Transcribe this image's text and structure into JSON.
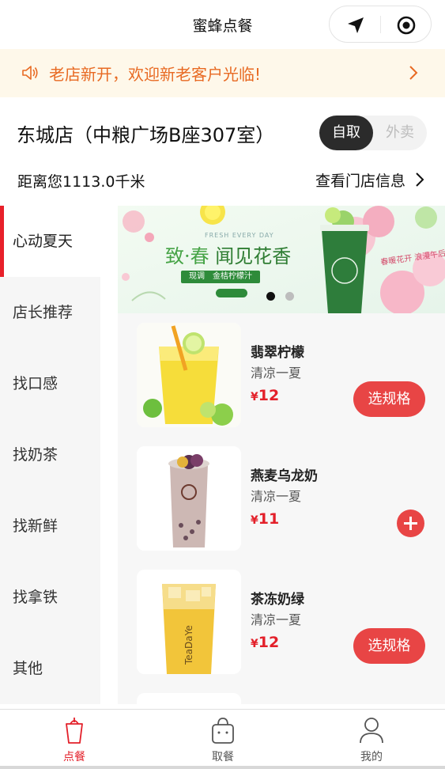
{
  "topbar": {
    "title": "蜜蜂点餐",
    "icons": [
      "location-arrow-icon",
      "target-icon"
    ]
  },
  "notice": {
    "text": "老店新开，欢迎新老客户光临!",
    "icon": "speaker-icon"
  },
  "store": {
    "name": "东城店（中粮广场B座307室）",
    "distance": "距离您1113.0千米",
    "info_link": "查看门店信息",
    "mode_selected": "自取",
    "mode_other": "外卖"
  },
  "categories": [
    {
      "label": "心动夏天",
      "active": true
    },
    {
      "label": "店长推荐",
      "active": false
    },
    {
      "label": "找口感",
      "active": false
    },
    {
      "label": "找奶茶",
      "active": false
    },
    {
      "label": "找新鲜",
      "active": false
    },
    {
      "label": "找拿铁",
      "active": false
    },
    {
      "label": "其他",
      "active": false
    }
  ],
  "banner": {
    "en": "FRESH EVERY DAY",
    "slogan_a": "致·春",
    "slogan_b": " 闻见花香",
    "pill": "现调　金桔柠檬汁",
    "side": "春暖花开 浪漫午后",
    "slides": 2,
    "current": 0
  },
  "products": [
    {
      "name": "翡翠柠檬",
      "desc": "清凉一夏",
      "currency": "¥",
      "price": "12",
      "action": "选规格",
      "action_type": "spec"
    },
    {
      "name": "燕麦乌龙奶",
      "desc": "清凉一夏",
      "currency": "¥",
      "price": "11",
      "action": "",
      "action_type": "add"
    },
    {
      "name": "茶冻奶绿",
      "desc": "清凉一夏",
      "currency": "¥",
      "price": "12",
      "action": "选规格",
      "action_type": "spec"
    }
  ],
  "tabs": [
    {
      "label": "点餐",
      "icon": "cup-icon",
      "active": true
    },
    {
      "label": "取餐",
      "icon": "bag-icon",
      "active": false
    },
    {
      "label": "我的",
      "icon": "user-icon",
      "active": false
    }
  ],
  "colors": {
    "accent": "#e84545",
    "price": "#e3202a",
    "notice_bg": "#fef8ea",
    "notice_text": "#e86a23",
    "active_tab": "#e3202a"
  }
}
